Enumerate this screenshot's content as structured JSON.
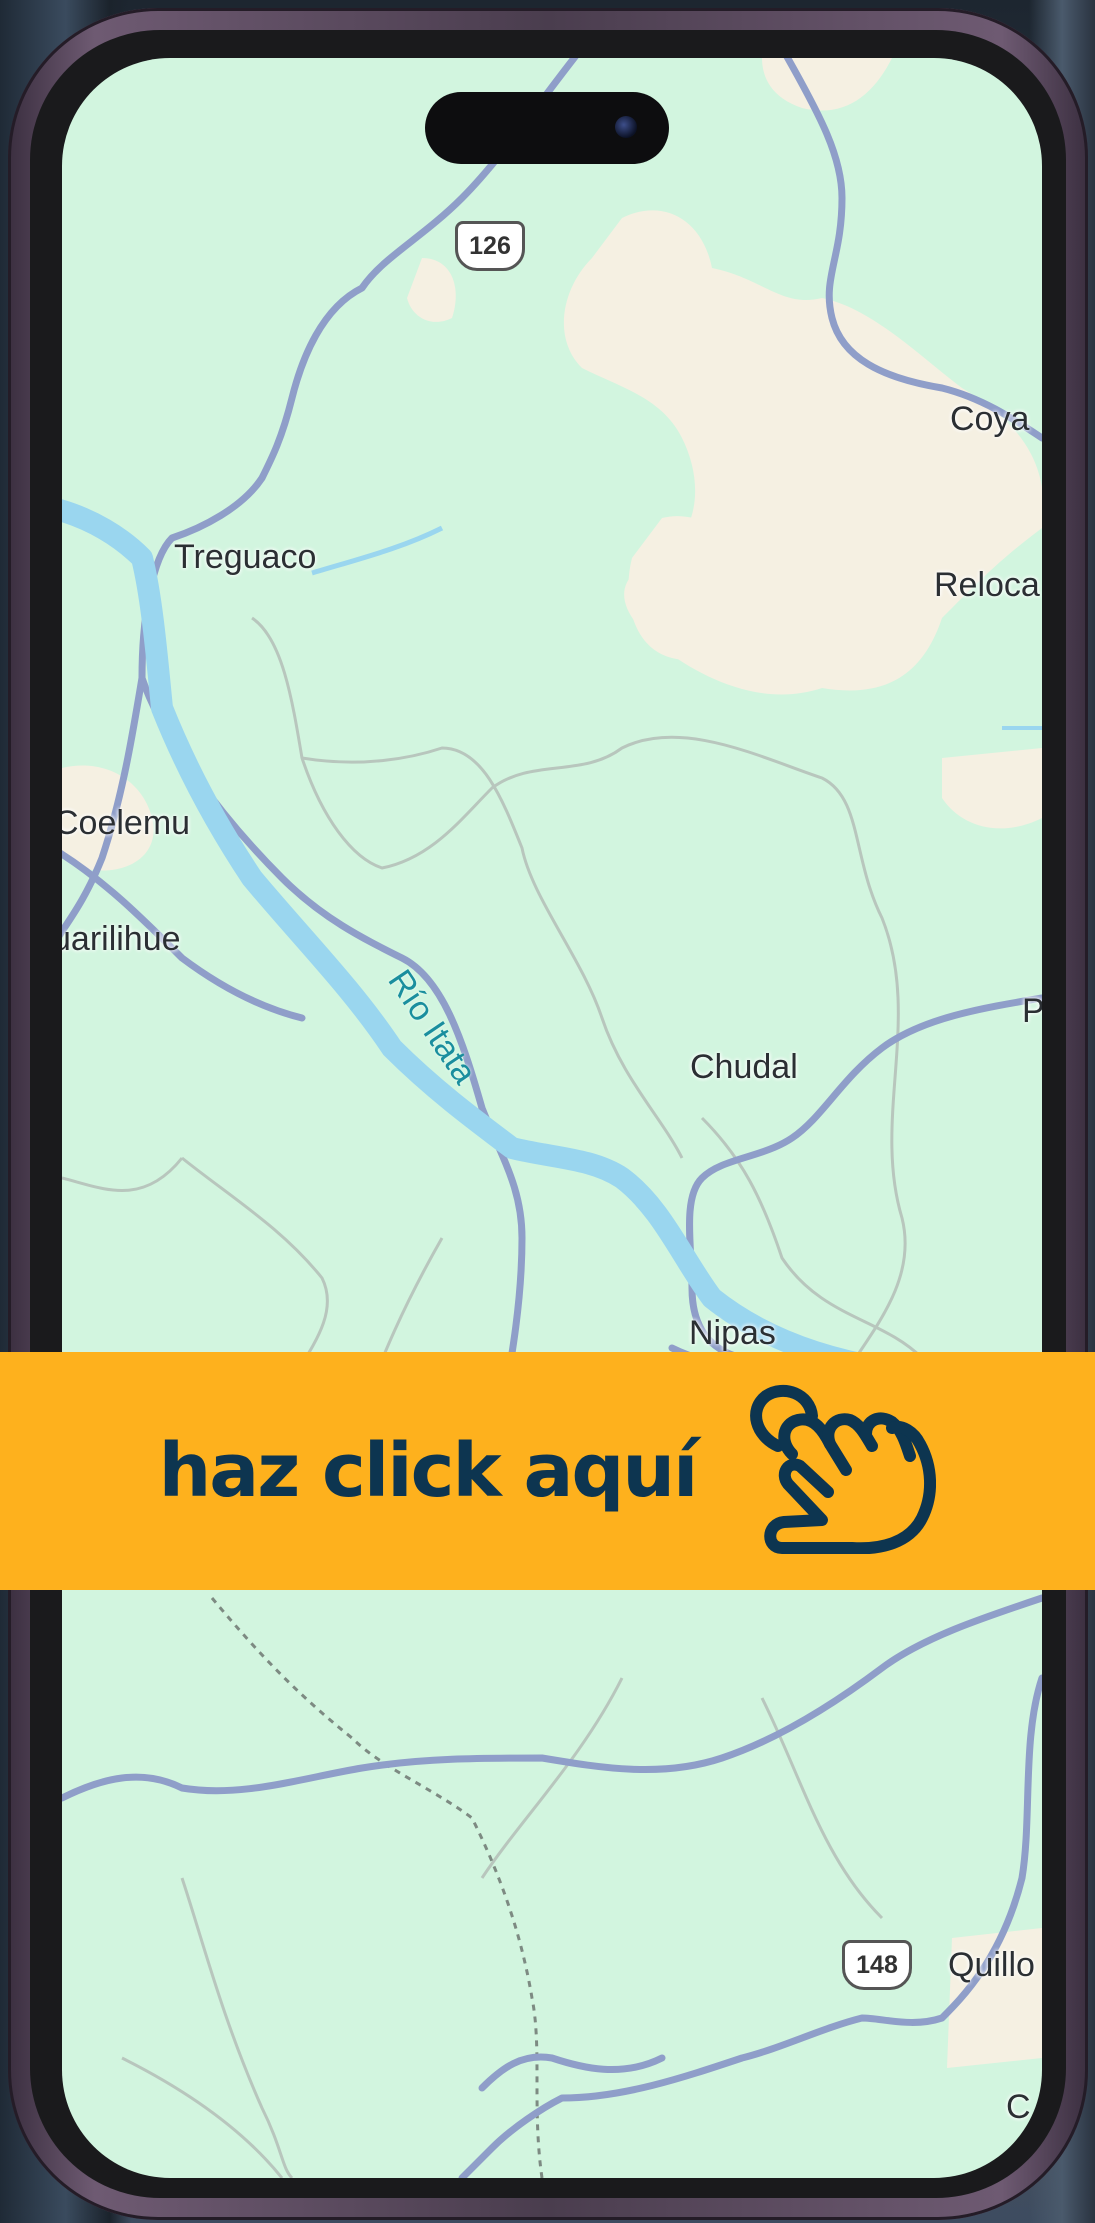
{
  "map": {
    "places": {
      "treguaco": "Treguaco",
      "coelemu": "Coelemu",
      "quirihue": "uarilihue",
      "chudal": "Chudal",
      "nipas": "Nipas",
      "coya": "Coya",
      "reloca": "Reloca",
      "p_edge": "P",
      "quillon": "Quillo",
      "c_edge": "C"
    },
    "river": {
      "name": "Río Itata"
    },
    "route_shields": [
      "126",
      "148"
    ],
    "colors": {
      "land": "#d2f5df",
      "urban": "#f5f0e2",
      "water": "#9ad6ef",
      "road": "#8f9ec9",
      "border": "#b8c6bd"
    }
  },
  "banner": {
    "text": "haz click aquí",
    "icon": "hand-pointer-icon",
    "background": "#feb11d",
    "text_color": "#0d3550"
  }
}
